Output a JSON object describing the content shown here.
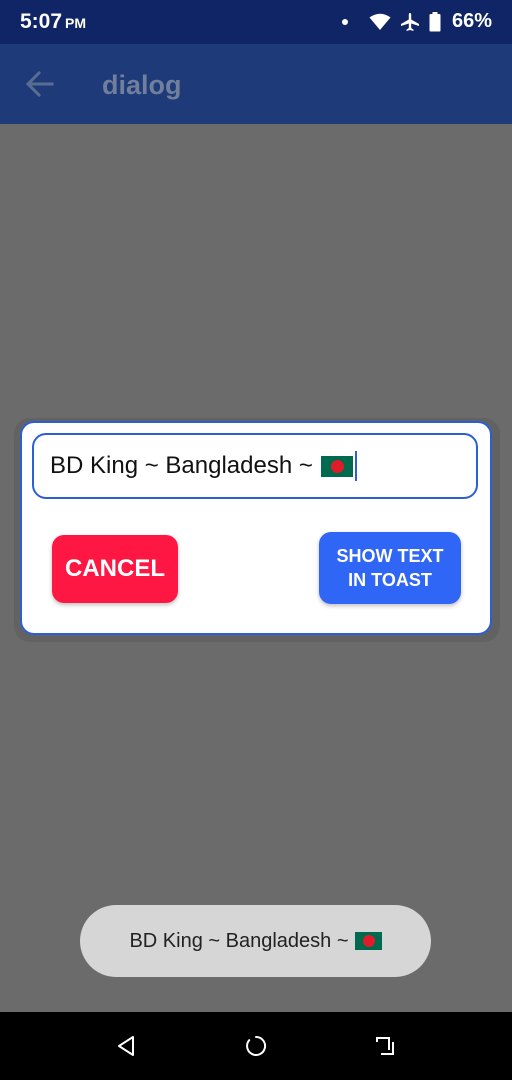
{
  "status_bar": {
    "time": "5:07",
    "ampm": "PM",
    "battery": "66%",
    "icons": [
      "notification-dot-icon",
      "wifi-icon",
      "airplane-icon",
      "battery-icon"
    ]
  },
  "app_bar": {
    "title": "dialog",
    "back_icon": "arrow-back-icon"
  },
  "dialog": {
    "input_value": "BD King ~ Bangladesh ~",
    "input_emoji": "bangladesh-flag",
    "cancel_label": "CANCEL",
    "show_label_line1": "SHOW TEXT",
    "show_label_line2": "IN TOAST"
  },
  "toast": {
    "text": "BD King ~ Bangladesh ~",
    "emoji": "bangladesh-flag"
  },
  "nav_bar": {
    "icons": [
      "nav-back-icon",
      "nav-home-icon",
      "nav-recents-icon"
    ]
  },
  "colors": {
    "status_bar": "#0f2566",
    "app_bar_dimmed": "#1e3a78",
    "scrim": "#6b6b6b",
    "accent_blue": "#2f66f5",
    "cancel_red": "#ff1744",
    "toast_bg": "#d6d6d6"
  }
}
